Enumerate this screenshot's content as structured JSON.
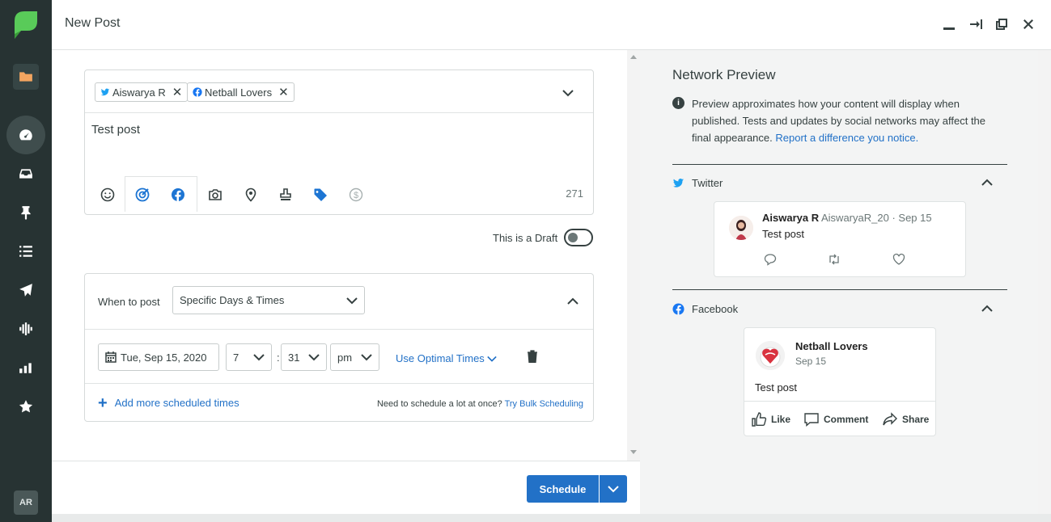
{
  "app": {
    "title": "New Post",
    "avatar_initials": "AR"
  },
  "sidebar": {
    "items": [
      {
        "name": "folder",
        "icon": "folder-icon"
      },
      {
        "name": "dashboard",
        "icon": "gauge-icon"
      },
      {
        "name": "inbox",
        "icon": "inbox-icon"
      },
      {
        "name": "pin",
        "icon": "pin-icon"
      },
      {
        "name": "list",
        "icon": "list-icon"
      },
      {
        "name": "send",
        "icon": "send-icon"
      },
      {
        "name": "listening",
        "icon": "waveform-icon"
      },
      {
        "name": "reports",
        "icon": "bar-chart-icon"
      },
      {
        "name": "reviews",
        "icon": "star-icon"
      }
    ]
  },
  "composer": {
    "profiles": [
      {
        "label": "Aiswarya R",
        "network": "twitter"
      },
      {
        "label": "Netball Lovers",
        "network": "facebook"
      }
    ],
    "text": "Test post",
    "char_count": "271"
  },
  "draft": {
    "label": "This is a Draft",
    "on": false
  },
  "schedule": {
    "when_label": "When to post",
    "when_value": "Specific Days & Times",
    "date": "Tue, Sep 15, 2020",
    "hour": "7",
    "minute": "31",
    "ampm": "pm",
    "optimal_label": "Use Optimal Times",
    "add_more_label": "Add more scheduled times",
    "bulk_prefix": "Need to schedule a lot at once?",
    "bulk_link": "Try Bulk Scheduling"
  },
  "footer": {
    "schedule_label": "Schedule"
  },
  "preview": {
    "title": "Network Preview",
    "info_text": "Preview approximates how your content will display when published. Tests and updates by social networks may affect the final appearance.",
    "info_link": "Report a difference you notice.",
    "twitter": {
      "header": "Twitter",
      "name": "Aiswarya R",
      "handle": "AiswaryaR_20",
      "date": "· Sep 15",
      "text": "Test post"
    },
    "facebook": {
      "header": "Facebook",
      "name": "Netball Lovers",
      "date": "Sep 15",
      "text": "Test post",
      "like": "Like",
      "comment": "Comment",
      "share": "Share"
    }
  },
  "colors": {
    "sidebar": "#273333",
    "accent": "#2271c7",
    "folder": "#f4a560",
    "logo": "#59cb59"
  }
}
